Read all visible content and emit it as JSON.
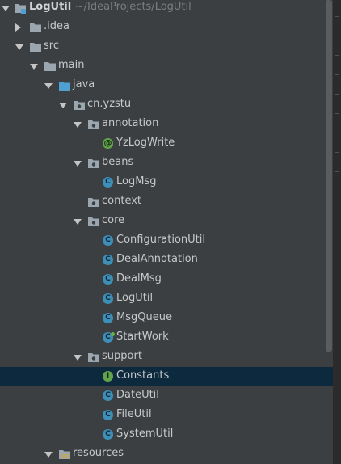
{
  "project": {
    "name": "LogUtil",
    "path": "~/IdeaProjects/LogUtil"
  },
  "tree": {
    "idea": ".idea",
    "src": "src",
    "main": "main",
    "java": "java",
    "package": "cn.yzstu",
    "annotation": "annotation",
    "yzlogwrite": "YzLogWrite",
    "beans": "beans",
    "logmsg": "LogMsg",
    "context": "context",
    "core": "core",
    "configurationutil": "ConfigurationUtil",
    "dealannotation": "DealAnnotation",
    "dealmsg": "DealMsg",
    "logutil": "LogUtil",
    "msgqueue": "MsgQueue",
    "startwork": "StartWork",
    "support": "support",
    "constants": "Constants",
    "dateutil": "DateUtil",
    "fileutil": "FileUtil",
    "systemutil": "SystemUtil",
    "resources": "resources"
  },
  "icons": {
    "class_badge": "C",
    "interface_badge": "I",
    "annotation_badge": "@"
  },
  "colors": {
    "background": "#3c3f41",
    "selection": "#0d293e",
    "class_icon": "#3d8fb8",
    "interface_icon": "#62a44c",
    "folder": "#9aa7b0",
    "source_folder": "#4f9fd0"
  }
}
